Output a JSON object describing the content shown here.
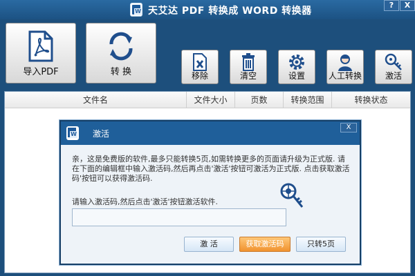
{
  "window": {
    "title": "天艾达 PDF 转换成 WORD 转换器",
    "help_label": "?",
    "close_label": "X"
  },
  "toolbar": {
    "import_label": "导入PDF",
    "convert_label": "转 换",
    "remove_label": "移除",
    "clear_label": "清空",
    "settings_label": "设置",
    "manual_label": "人工转换",
    "activate_label": "激活"
  },
  "table": {
    "columns": [
      "文件名",
      "文件大小",
      "页数",
      "转换范围",
      "转换状态"
    ]
  },
  "dialog": {
    "title": "激活",
    "close_label": "X",
    "message": "亲，这是免费版的软件,最多只能转换5页,如需转换更多的页面请升级为正式版. 请在下面的编辑框中输入激活码,然后再点击'激活'按钮可激活为正式版. 点击获取激活码'按钮可以获得激活码.",
    "prompt": "请输入激活码,然后点击'激活'按钮激活软件.",
    "input_value": "",
    "activate_button": "激 活",
    "get_code_button": "获取激活码",
    "five_pages_button": "只转5页"
  },
  "colors": {
    "window_bg": "#1d4f7c",
    "dialog_title_bg": "#1f5f9a",
    "orange_accent": "#f0922f"
  }
}
